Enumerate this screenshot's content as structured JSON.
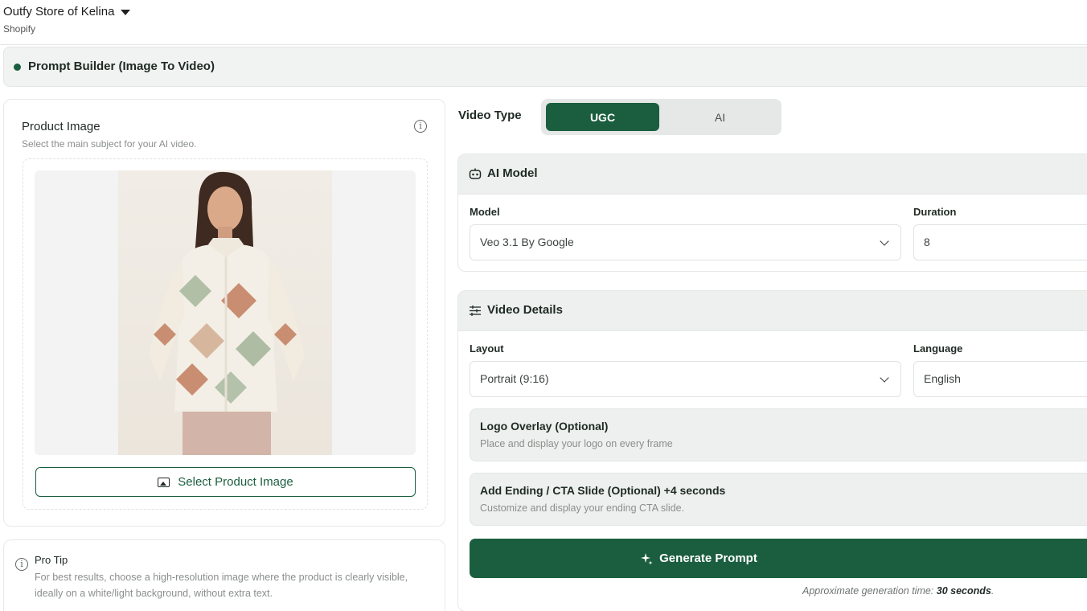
{
  "header": {
    "store_name": "Outfy Store of Kelina",
    "platform": "Shopify"
  },
  "page": {
    "title": "Prompt Builder (Image To Video)"
  },
  "product_image": {
    "label": "Product Image",
    "subtitle": "Select the main subject for your AI video.",
    "select_button": "Select Product Image"
  },
  "pro_tip": {
    "title": "Pro Tip",
    "text": "For best results, choose a high-resolution image where the product is clearly visible, ideally on a white/light background, without extra text."
  },
  "video_type": {
    "label": "Video Type",
    "options": [
      "UGC",
      "AI"
    ],
    "selected": "UGC"
  },
  "ai_model": {
    "title": "AI Model",
    "model_label": "Model",
    "model_value": "Veo 3.1 By Google",
    "duration_label": "Duration",
    "duration_value": "8"
  },
  "video_details": {
    "title": "Video Details",
    "layout_label": "Layout",
    "layout_value": "Portrait (9:16)",
    "language_label": "Language",
    "language_value": "English",
    "logo_overlay_title": "Logo Overlay (Optional)",
    "logo_overlay_desc": "Place and display your logo on every frame",
    "ending_title": "Add Ending / CTA Slide (Optional) +4 seconds",
    "ending_desc": "Customize and display your ending CTA slide."
  },
  "generate": {
    "button_label": "Generate Prompt",
    "time_prefix": "Approximate generation time:",
    "time_value": "30 seconds",
    "time_suffix": "."
  },
  "colors": {
    "accent": "#1b5e3f",
    "panel": "#edf0ee",
    "muted_text": "#8a8f8c"
  },
  "icons": [
    "chevron-down-icon",
    "info-icon",
    "image-icon",
    "robot-icon",
    "sliders-icon",
    "sparkle-icon"
  ]
}
